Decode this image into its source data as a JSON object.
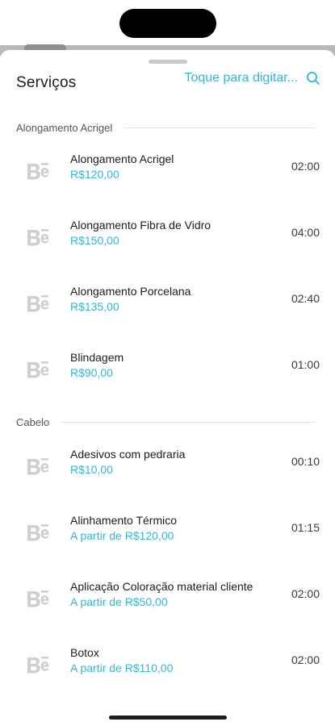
{
  "header": {
    "title": "Serviços",
    "search_label": "Toque para digitar..."
  },
  "icons": {
    "search": "search-icon",
    "service_logo": "brand-logo-icon"
  },
  "colors": {
    "accent": "#35b4d6",
    "text": "#1c1c1e",
    "logo_gray": "#cfcfcf"
  },
  "sections": [
    {
      "label": "Alongamento Acrigel",
      "items": [
        {
          "name": "Alongamento Acrigel",
          "price": "R$120,00",
          "duration": "02:00"
        },
        {
          "name": "Alongamento Fibra de Vidro",
          "price": "R$150,00",
          "duration": "04:00"
        },
        {
          "name": "Alongamento Porcelana",
          "price": "R$135,00",
          "duration": "02:40"
        },
        {
          "name": "Blindagem",
          "price": "R$90,00",
          "duration": "01:00"
        }
      ]
    },
    {
      "label": "Cabelo",
      "items": [
        {
          "name": "Adesivos com pedraria",
          "price": "R$10,00",
          "duration": "00:10"
        },
        {
          "name": "Alinhamento Térmico",
          "price": "A partir de R$120,00",
          "duration": "01:15"
        },
        {
          "name": "Aplicação Coloração material cliente",
          "price": "A partir de R$50,00",
          "duration": "02:00"
        },
        {
          "name": "Botox",
          "price": "A partir de R$110,00",
          "duration": "02:00"
        }
      ]
    }
  ]
}
